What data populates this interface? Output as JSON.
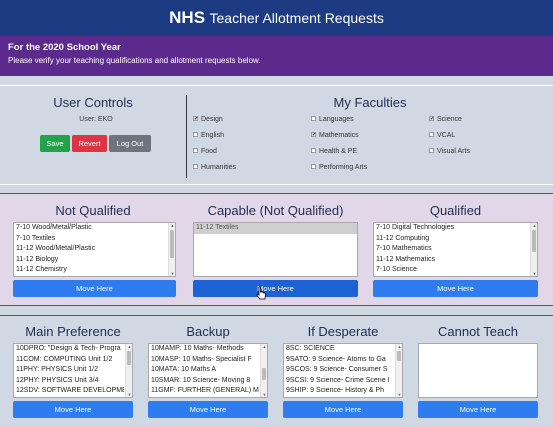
{
  "header": {
    "brand": "NHS",
    "title": "Teacher Allotment Requests"
  },
  "banner": {
    "heading": "For the 2020 School Year",
    "subtext": "Please verify your teaching qualifications and allotment requests below."
  },
  "user_controls": {
    "title": "User Controls",
    "user_label": "User: EKO",
    "save_label": "Save",
    "revert_label": "Revert",
    "logout_label": "Log Out"
  },
  "faculties": {
    "title": "My Faculties",
    "items": [
      {
        "label": "Design",
        "checked": true
      },
      {
        "label": "Languages",
        "checked": false
      },
      {
        "label": "Science",
        "checked": true
      },
      {
        "label": "English",
        "checked": false
      },
      {
        "label": "Mathematics",
        "checked": true
      },
      {
        "label": "VCAL",
        "checked": false
      },
      {
        "label": "Food",
        "checked": false
      },
      {
        "label": "Health & PE",
        "checked": false
      },
      {
        "label": "Visual Arts",
        "checked": false
      },
      {
        "label": "Humanities",
        "checked": false
      },
      {
        "label": "Performing Arts",
        "checked": false
      }
    ]
  },
  "qualification": {
    "not_qualified": {
      "title": "Not Qualified",
      "items": [
        "7-10 Wood/Metal/Plastic",
        "7-10 Textiles",
        "11-12 Wood/Metal/Plastic",
        "11-12 Biology",
        "11-12 Chemistry"
      ],
      "button": "Move Here"
    },
    "capable": {
      "title": "Capable (Not Qualified)",
      "items": [
        "11-12 Textiles"
      ],
      "button": "Move Here"
    },
    "qualified": {
      "title": "Qualified",
      "items": [
        "7-10 Digital Technologies",
        "11-12 Computing",
        "7-10 Mathematics",
        "11-12 Mathematics",
        "7-10 Science"
      ],
      "button": "Move Here"
    }
  },
  "preferences": {
    "main": {
      "title": "Main Preference",
      "items": [
        "10DPRO: \"Design & Tech- Progra",
        "11COM: COMPUTING Unit 1/2",
        "11PHY: PHYSICS Unit 1/2",
        "12PHY: PHYSICS Unit 3/4",
        "12SDV: SOFTWARE DEVELOPMEN"
      ],
      "button": "Move Here"
    },
    "backup": {
      "title": "Backup",
      "items": [
        "10MAMP: 10 Maths- Methods",
        "10MASP: 10 Maths- Specialist F",
        "10MATA: 10 Maths A",
        "10SMAR: 10 Science- Moving 8",
        "11GMF: FURTHER (GENERAL) M"
      ],
      "button": "Move Here"
    },
    "desperate": {
      "title": "If Desperate",
      "items": [
        "8SC: SCIENCE",
        "9SATO: 9 Science- Atoms to Ga",
        "9SCOS: 9 Science- Consumer S",
        "9SCSI: 9 Science- Crime Scene I",
        "9SHIP: 9 Science- History & Ph"
      ],
      "button": "Move Here"
    },
    "cannot": {
      "title": "Cannot Teach",
      "items": [],
      "button": "Move Here"
    }
  }
}
